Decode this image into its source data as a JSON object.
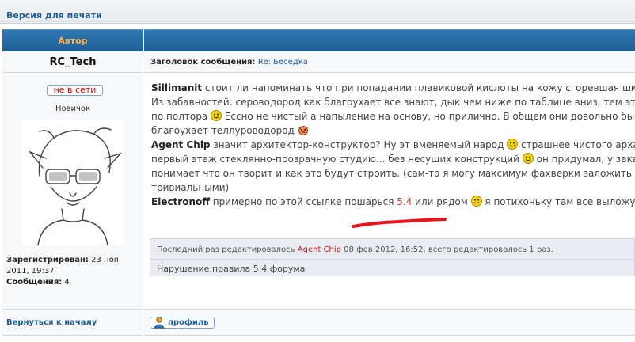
{
  "print_link": "Версия для печати",
  "header": {
    "author_label": "Автор"
  },
  "author": {
    "name": "RC_Tech",
    "status": "не в сети",
    "rank": "Новичок",
    "registered_label": "Зарегистрирован:",
    "registered_value": "23 ноя 2011, 19:37",
    "posts_label": "Сообщения:",
    "posts_value": "4"
  },
  "subject": {
    "label": "Заголовок сообщения:",
    "value": "Re: Беседка"
  },
  "post": {
    "l1_nick": "Sillimanit",
    "l1_text": " стоит ли напоминать что при попадании плавиковой кислоты на кожу сгоревшая шкура это",
    "l2_text": "Из забавностей: сероводород как благоухает все знают, дык чем ниже по таблице вниз, тем этот эф",
    "l3a": "по полтора ",
    "l3b": " Ессно не чистый а напыление на основу, но прилично. В общем они довольно быстро",
    "l4": "благоухает теллуроводород ",
    "l5_nick": "Agent Chip",
    "l5_text": " значит архитектор-конструктор? Ну эт вменяемый народ ",
    "l5_tail": " страшнее чистого арха тольк",
    "l6a": "первый этаж стеклянно-прозрачную студию... без несущих конструкций ",
    "l6b": " он придумал, у заказчика",
    "l7": "понимает что он творит и как это будут строить. (сам-то я могу максимум фахверки заложить или б",
    "l8": "тривиальными)",
    "l9_nick": "Electronoff",
    "l9_text": " примерно по этой ссылке пошарься ",
    "l9_link": "5.4",
    "l9_mid": " или рядом ",
    "l9_tail": " я потихоньку там все выложу"
  },
  "edited": {
    "prefix": "Последний раз редактировалось ",
    "editor": "Agent Chip",
    "suffix": " 08 фев 2012, 16:52, всего редактировалось 1 раз.",
    "reason": "Нарушение правила 5.4 форума"
  },
  "footer": {
    "back_link": "Вернуться к началу",
    "profile_button": "профиль"
  },
  "colors": {
    "header_blue": "#1f5f95",
    "author_label": "#ffb14a",
    "link_red": "#c0392b",
    "annotation_red": "#e8141b"
  }
}
